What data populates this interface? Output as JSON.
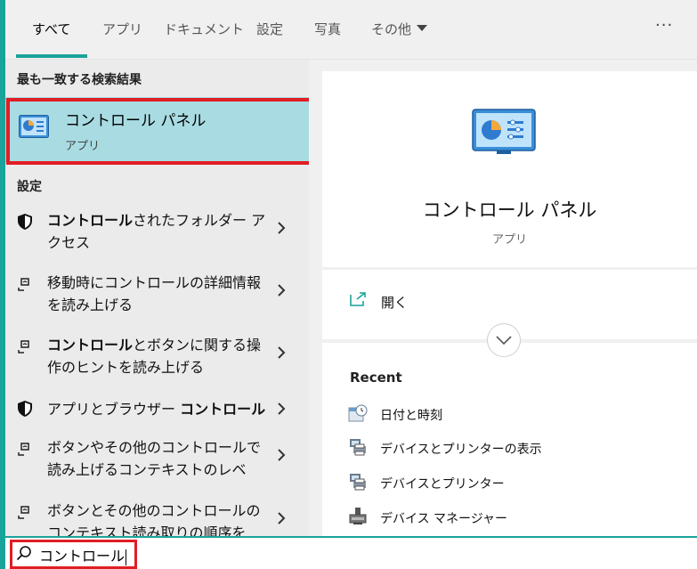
{
  "tabs": [
    {
      "label": "すべて"
    },
    {
      "label": "アプリ"
    },
    {
      "label": "ドキュメント"
    },
    {
      "label": "設定"
    },
    {
      "label": "写真"
    },
    {
      "label": "その他"
    }
  ],
  "more_label": "···",
  "left": {
    "best_match_heading": "最も一致する検索結果",
    "best_match": {
      "title": "コントロール パネル",
      "subtitle": "アプリ"
    },
    "settings_heading": "設定",
    "settings": [
      {
        "bold": "コントロール",
        "rest": "されたフォルダー アクセス",
        "icon": "shield-icon"
      },
      {
        "bold": "",
        "rest": "移動時にコントロールの詳細情報を読み上げる",
        "icon": "narrator-icon"
      },
      {
        "bold": "コントロール",
        "rest": "とボタンに関する操作のヒントを読み上げる",
        "icon": "narrator-icon"
      },
      {
        "pre": "アプリとブラウザー ",
        "bold": "コントロール",
        "icon": "shield-icon"
      },
      {
        "bold": "",
        "rest": "ボタンやその他のコントロールで読み上げるコンテキストのレベ",
        "icon": "narrator-icon"
      },
      {
        "bold": "",
        "rest": "ボタンとその他のコントロールのコンテキスト読み取りの順序を",
        "icon": "narrator-icon"
      }
    ]
  },
  "right": {
    "title": "コントロール パネル",
    "subtitle": "アプリ",
    "open_label": "開く",
    "recent_heading": "Recent",
    "recent": [
      {
        "label": "日付と時刻",
        "icon": "clock-icon"
      },
      {
        "label": "デバイスとプリンターの表示",
        "icon": "printer-icon"
      },
      {
        "label": "デバイスとプリンター",
        "icon": "printer-icon"
      },
      {
        "label": "デバイス マネージャー",
        "icon": "device-manager-icon"
      }
    ]
  },
  "search": {
    "value": "コントロール"
  },
  "colors": {
    "accent": "#1aa39a",
    "highlight": "#a8dce2",
    "annotation": "#e11d24"
  }
}
